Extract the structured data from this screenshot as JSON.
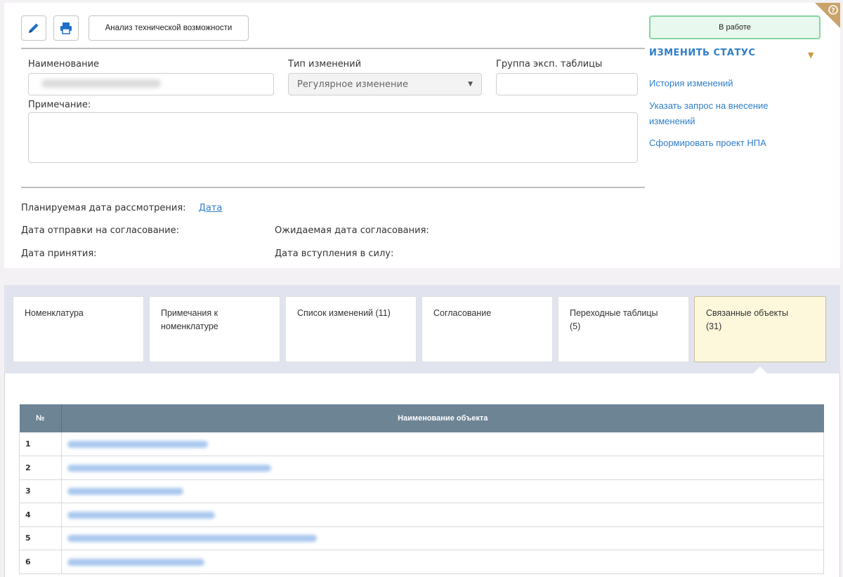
{
  "toolbar": {
    "edit_icon": "pencil-icon",
    "print_icon": "printer-icon",
    "analysis_label": "Анализ технической возможности"
  },
  "form": {
    "name_label": "Наименование",
    "change_type_label": "Тип изменений",
    "change_type_value": "Регулярное изменение",
    "group_label": "Группа эксп. таблицы",
    "note_label": "Примечание:"
  },
  "dates": {
    "planned_label": "Планируемая дата рассмотрения:",
    "planned_link": "Дата",
    "sent_label": "Дата отправки на согласование:",
    "expected_label": "Ожидаемая дата согласования:",
    "accepted_label": "Дата принятия:",
    "effective_label": "Дата вступления в силу:"
  },
  "sidebar": {
    "status": "В работе",
    "change_status": "ИЗМЕНИТЬ СТАТУС",
    "links": {
      "history": "История изменений",
      "request_line1": "Указать запрос на внесение",
      "request_line2": "изменений",
      "npa": "Сформировать проект НПА"
    }
  },
  "tabs": [
    {
      "line1": "Номенклатура",
      "line2": ""
    },
    {
      "line1": "Примечания к",
      "line2": "номенклатуре"
    },
    {
      "line1": "Список изменений (11)",
      "line2": ""
    },
    {
      "line1": "Согласование",
      "line2": ""
    },
    {
      "line1": "Переходные таблицы",
      "line2": "(5)"
    },
    {
      "line1": "Связанные объекты",
      "line2": "(31)"
    }
  ],
  "active_tab_index": 5,
  "table": {
    "columns": [
      "№",
      "Наименование объекта"
    ],
    "rows": [
      "1",
      "2",
      "3",
      "4",
      "5",
      "6"
    ]
  },
  "colors": {
    "accent_link": "#2f7ec9",
    "table_header": "#6d8495",
    "status_border": "#86d6a2",
    "active_tab": "#fdf7dc"
  }
}
